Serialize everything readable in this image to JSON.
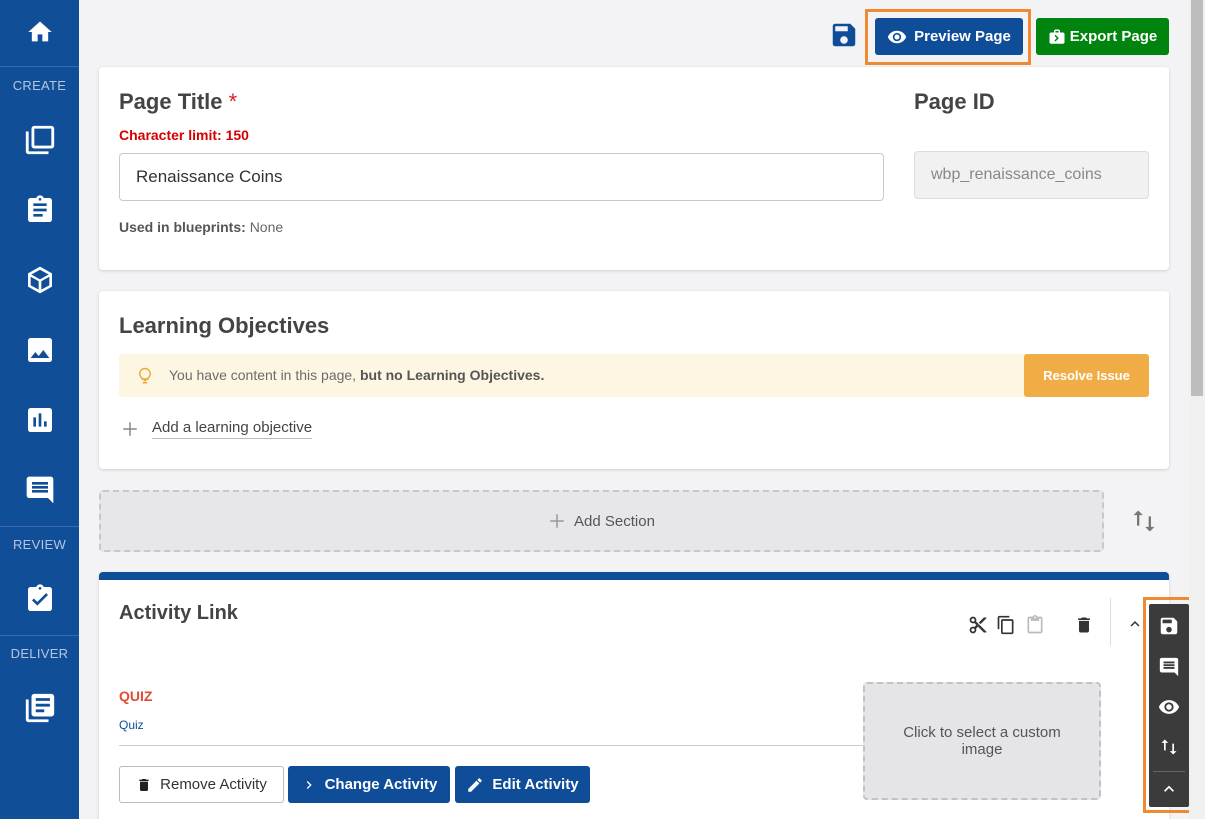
{
  "sidebar": {
    "sections": {
      "create": "CREATE",
      "review": "REVIEW",
      "deliver": "DELIVER"
    }
  },
  "toolbar": {
    "preview_label": "Preview Page",
    "export_label": "Export Page"
  },
  "page_title_card": {
    "title_label": "Page Title",
    "required_mark": "*",
    "char_limit": "Character limit: 150",
    "title_value": "Renaissance Coins",
    "used_in_label": "Used in blueprints:",
    "used_in_value": "None",
    "page_id_label": "Page ID",
    "page_id_value": "wbp_renaissance_coins"
  },
  "learning_objectives": {
    "heading": "Learning Objectives",
    "warning_prefix": "You have content in this page,",
    "warning_bold": "but no Learning Objectives.",
    "resolve_label": "Resolve Issue",
    "add_label": "Add a learning objective"
  },
  "add_section_label": "Add Section",
  "activity": {
    "title": "Activity Link",
    "type_label": "QUIZ",
    "type_sub": "Quiz",
    "image_placeholder": "Click to select a custom image",
    "remove_label": "Remove Activity",
    "change_label": "Change Activity",
    "edit_label": "Edit Activity"
  },
  "colors": {
    "sidebar": "#104e98",
    "primary": "#0f4d99",
    "export": "#00840f",
    "warning_bg": "#fdf6e3",
    "resolve": "#f0ad45",
    "highlight": "#f08a32"
  }
}
